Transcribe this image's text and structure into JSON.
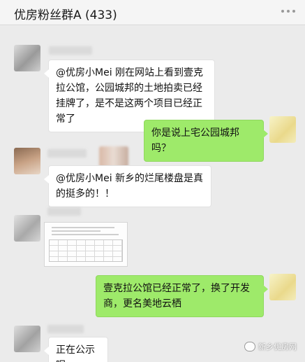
{
  "header": {
    "title": "优房粉丝群A (433)",
    "more_icon": "more-icon"
  },
  "messages": [
    {
      "side": "left",
      "text": "@优房小Mei   刚在网站上看到壹克拉公馆，公园城邦的土地拍卖已经挂牌了，是不是这两个项目已经正常了"
    },
    {
      "side": "right",
      "text": "你是说上宅公园城邦吗？"
    },
    {
      "side": "left",
      "text": "@优房小Mei 新乡的烂尾楼盘是真的挺多的！！"
    },
    {
      "side": "left",
      "type": "image",
      "description_icon": "document-image"
    },
    {
      "side": "right",
      "text": "壹克拉公馆已经正常了，换了开发商，更名美地云栖"
    },
    {
      "side": "left",
      "text": "正在公示呢"
    }
  ],
  "watermark": {
    "text": "新乡优房网",
    "icon": "wechat-icon"
  }
}
